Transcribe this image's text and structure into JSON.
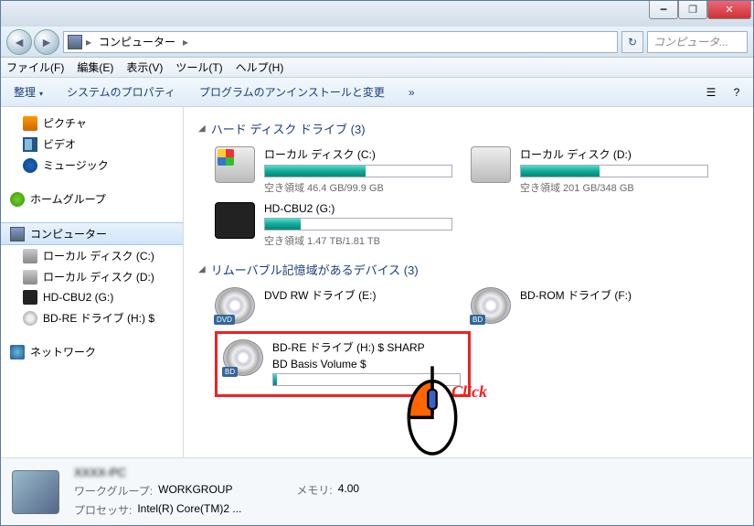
{
  "window": {
    "min_glyph": "━",
    "max_glyph": "❐",
    "close_glyph": "✕"
  },
  "nav": {
    "back_glyph": "◄",
    "fwd_glyph": "►",
    "crumb1": "コンピューター",
    "crumb_sep": "▸",
    "refresh_glyph": "↻",
    "search_placeholder": "コンピュータ..."
  },
  "menu": {
    "file": "ファイル(F)",
    "edit": "編集(E)",
    "view": "表示(V)",
    "tools": "ツール(T)",
    "help": "ヘルプ(H)"
  },
  "toolbar": {
    "organize": "整理",
    "sysprops": "システムのプロパティ",
    "uninstall": "プログラムのアンインストールと変更",
    "more": "»",
    "view_glyph": "☰",
    "help_glyph": "?"
  },
  "sidebar": {
    "pictures": "ピクチャ",
    "videos": "ビデオ",
    "music": "ミュージック",
    "homegroup": "ホームグループ",
    "computer": "コンピューター",
    "drive_c": "ローカル ディスク (C:)",
    "drive_d": "ローカル ディスク (D:)",
    "drive_g": "HD-CBU2 (G:)",
    "drive_h": "BD-RE ドライブ (H:) $",
    "network": "ネットワーク"
  },
  "sections": {
    "hdd_title": "ハード ディスク ドライブ (3)",
    "removable_title": "リムーバブル記憶域があるデバイス (3)",
    "triangle": "◢"
  },
  "drives": {
    "c": {
      "name": "ローカル ディスク (C:)",
      "free": "空き領域 46.4 GB/99.9 GB",
      "pct": 54
    },
    "d": {
      "name": "ローカル ディスク (D:)",
      "free": "空き領域 201 GB/348 GB",
      "pct": 42
    },
    "g": {
      "name": "HD-CBU2 (G:)",
      "free": "空き領域 1.47 TB/1.81 TB",
      "pct": 19
    },
    "e": {
      "name": "DVD RW ドライブ (E:)"
    },
    "f": {
      "name": "BD-ROM ドライブ (F:)"
    },
    "h": {
      "name": "BD-RE ドライブ (H:) $ SHARP",
      "sub": "BD Basis Volume $"
    }
  },
  "footer": {
    "pcname": "XXXX-PC",
    "mem_label": "メモリ:",
    "mem_val": "4.00",
    "wg_label": "ワークグループ:",
    "wg_val": "WORKGROUP",
    "cpu_label": "プロセッサ:",
    "cpu_val": "Intel(R) Core(TM)2 ..."
  },
  "annotation": {
    "click": "Click"
  }
}
